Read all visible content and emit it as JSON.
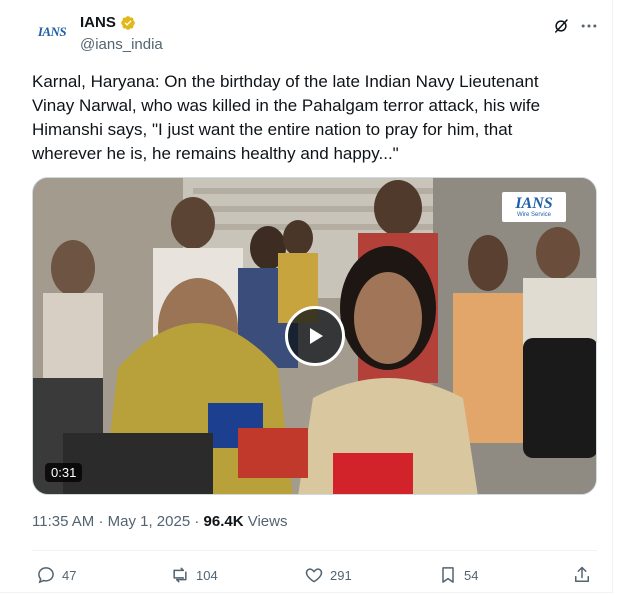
{
  "author": {
    "avatar_text": "IANS",
    "display_name": "IANS",
    "handle": "@ians_india",
    "verified_badge_color": "#e2b719"
  },
  "header_icons": {
    "grok": "grok-icon",
    "more": "more-horizontal-icon"
  },
  "tweet": {
    "text": "Karnal, Haryana: On the birthday of the late Indian Navy Lieutenant\nVinay Narwal, who was killed in the Pahalgam terror attack, his wife\nHimanshi says, \"I just want the entire nation to pray for him, that\nwherever he is, he remains healthy and happy...\""
  },
  "media": {
    "type": "video",
    "duration": "0:31",
    "watermark_main": "IANS",
    "watermark_sub": "Wire Service"
  },
  "meta": {
    "time": "11:35 AM",
    "separator": "·",
    "date": "May 1, 2025",
    "views_count": "96.4K",
    "views_label": "Views"
  },
  "actions": {
    "replies": "47",
    "reposts": "104",
    "likes": "291",
    "bookmarks": "54"
  },
  "colors": {
    "text_primary": "#0f1419",
    "text_secondary": "#536471",
    "border": "#eff3f4",
    "brand_blue": "#1f5fa8"
  }
}
